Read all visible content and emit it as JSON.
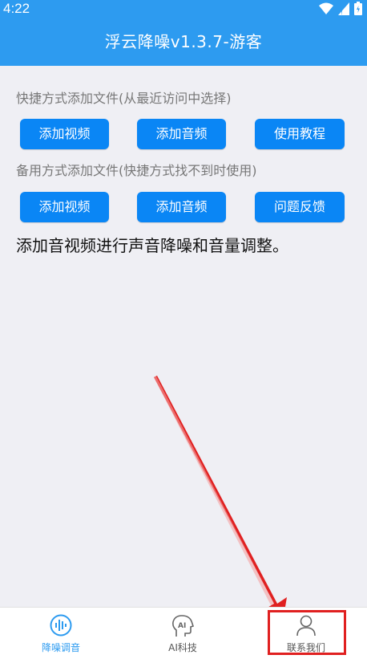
{
  "status_bar": {
    "time": "4:22"
  },
  "header": {
    "title": "浮云降噪v1.3.7-游客"
  },
  "section1": {
    "label": "快捷方式添加文件(从最近访问中选择)",
    "buttons": [
      "添加视频",
      "添加音频",
      "使用教程"
    ]
  },
  "section2": {
    "label": "备用方式添加文件(快捷方式找不到时使用)",
    "buttons": [
      "添加视频",
      "添加音频",
      "问题反馈"
    ]
  },
  "description": "添加音视频进行声音降噪和音量调整。",
  "bottom_nav": {
    "items": [
      {
        "label": "降噪调音",
        "icon": "waveform-icon",
        "active": true
      },
      {
        "label": "AI科技",
        "icon": "ai-head-icon",
        "active": false
      },
      {
        "label": "联系我们",
        "icon": "person-icon",
        "active": false
      }
    ]
  },
  "colors": {
    "accent": "#2d9bf0",
    "button": "#0a86f5",
    "highlight": "#e02020"
  }
}
